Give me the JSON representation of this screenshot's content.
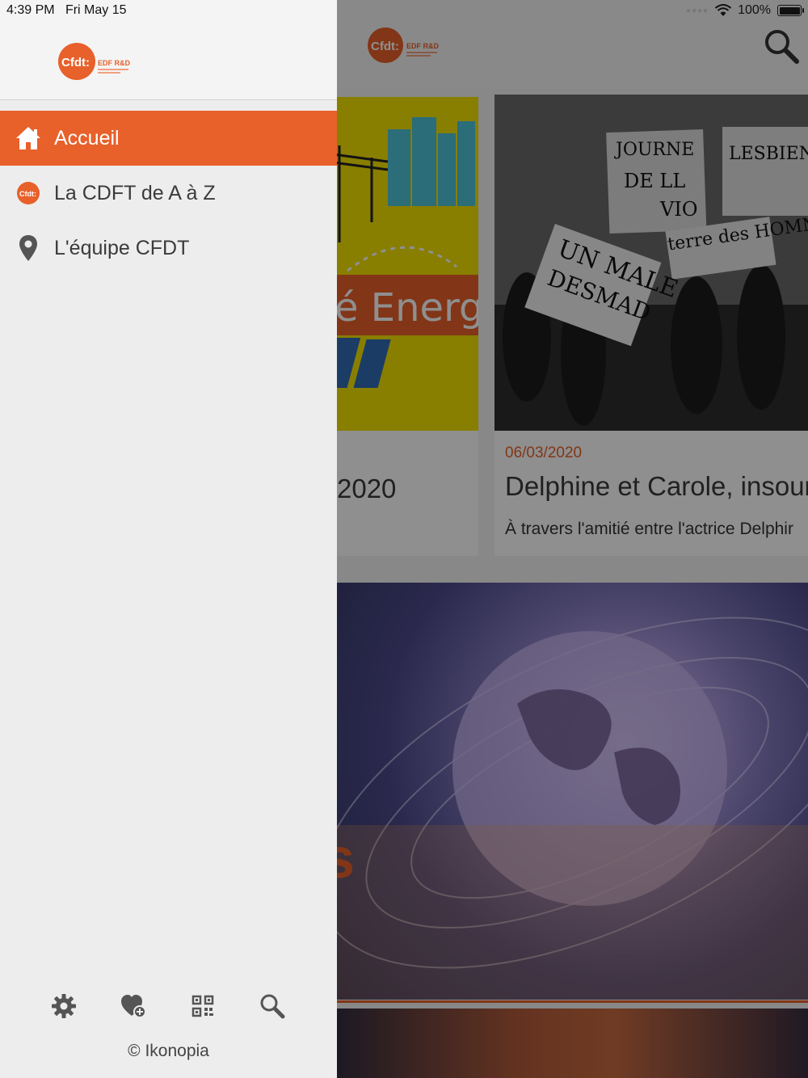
{
  "status_bar": {
    "time": "4:39 PM",
    "date": "Fri May 15",
    "battery": "100%",
    "icons": [
      "cellular-dots-icon",
      "wifi-icon",
      "battery-icon"
    ]
  },
  "drawer": {
    "logo": {
      "mark": "Cfdt:",
      "subtitle": "EDF R&D"
    },
    "menu": [
      {
        "label": "Accueil",
        "icon": "home-icon",
        "active": true
      },
      {
        "label": "La CDFT de A à Z",
        "icon": "cfdt-logo-icon",
        "active": false
      },
      {
        "label": "L'équipe CFDT",
        "icon": "map-pin-icon",
        "active": false
      }
    ],
    "toolbar": [
      {
        "icon": "gear-icon"
      },
      {
        "icon": "heart-add-icon"
      },
      {
        "icon": "qr-code-icon"
      },
      {
        "icon": "search-icon"
      }
    ],
    "copyright": "© Ikonopia"
  },
  "background": {
    "header": {
      "logo_mark": "Cfdt:",
      "logo_subtitle": "EDF R&D",
      "search_icon": "search-icon"
    },
    "cards": [
      {
        "image_text": "é Energi",
        "title": "2020"
      },
      {
        "date": "06/03/2020",
        "title": "Delphine et Carole, insour",
        "excerpt": "À travers l'amitié entre l'actrice Delphir",
        "image_signs": [
          "JOURNE",
          "LESBIEN",
          "DE LL",
          "VIO",
          "UN MALE",
          "DESMAD",
          "terre des HOMMES"
        ]
      }
    ],
    "hero_fragment": "s"
  },
  "colors": {
    "accent": "#e8602a",
    "drawer_bg": "#ededed",
    "text": "#3b3b3b"
  }
}
